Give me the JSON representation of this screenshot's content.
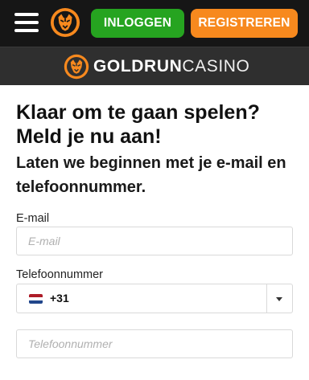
{
  "header": {
    "menu_icon": "hamburger-menu-icon",
    "login_label": "INLOGGEN",
    "register_label": "REGISTREREN",
    "colors": {
      "topbar": "#161616",
      "login": "#26a420",
      "register": "#f7891e",
      "brand_bar": "#2f2f2f",
      "logo_orange": "#f7891e"
    }
  },
  "brand": {
    "name_bold": "GOLDRUN",
    "name_light": "CASINO",
    "logo_icon": "tiger-logo-icon"
  },
  "form": {
    "title": "Klaar om te gaan spelen? Meld je nu aan!",
    "subtitle": "Laten we beginnen met je e-mail en telefoonnummer.",
    "email_label": "E-mail",
    "email_placeholder": "E-mail",
    "phone_label": "Telefoonnummer",
    "country_flag": "netherlands-flag-icon",
    "dial_code": "+31",
    "phone_placeholder": "Telefoonnummer"
  }
}
